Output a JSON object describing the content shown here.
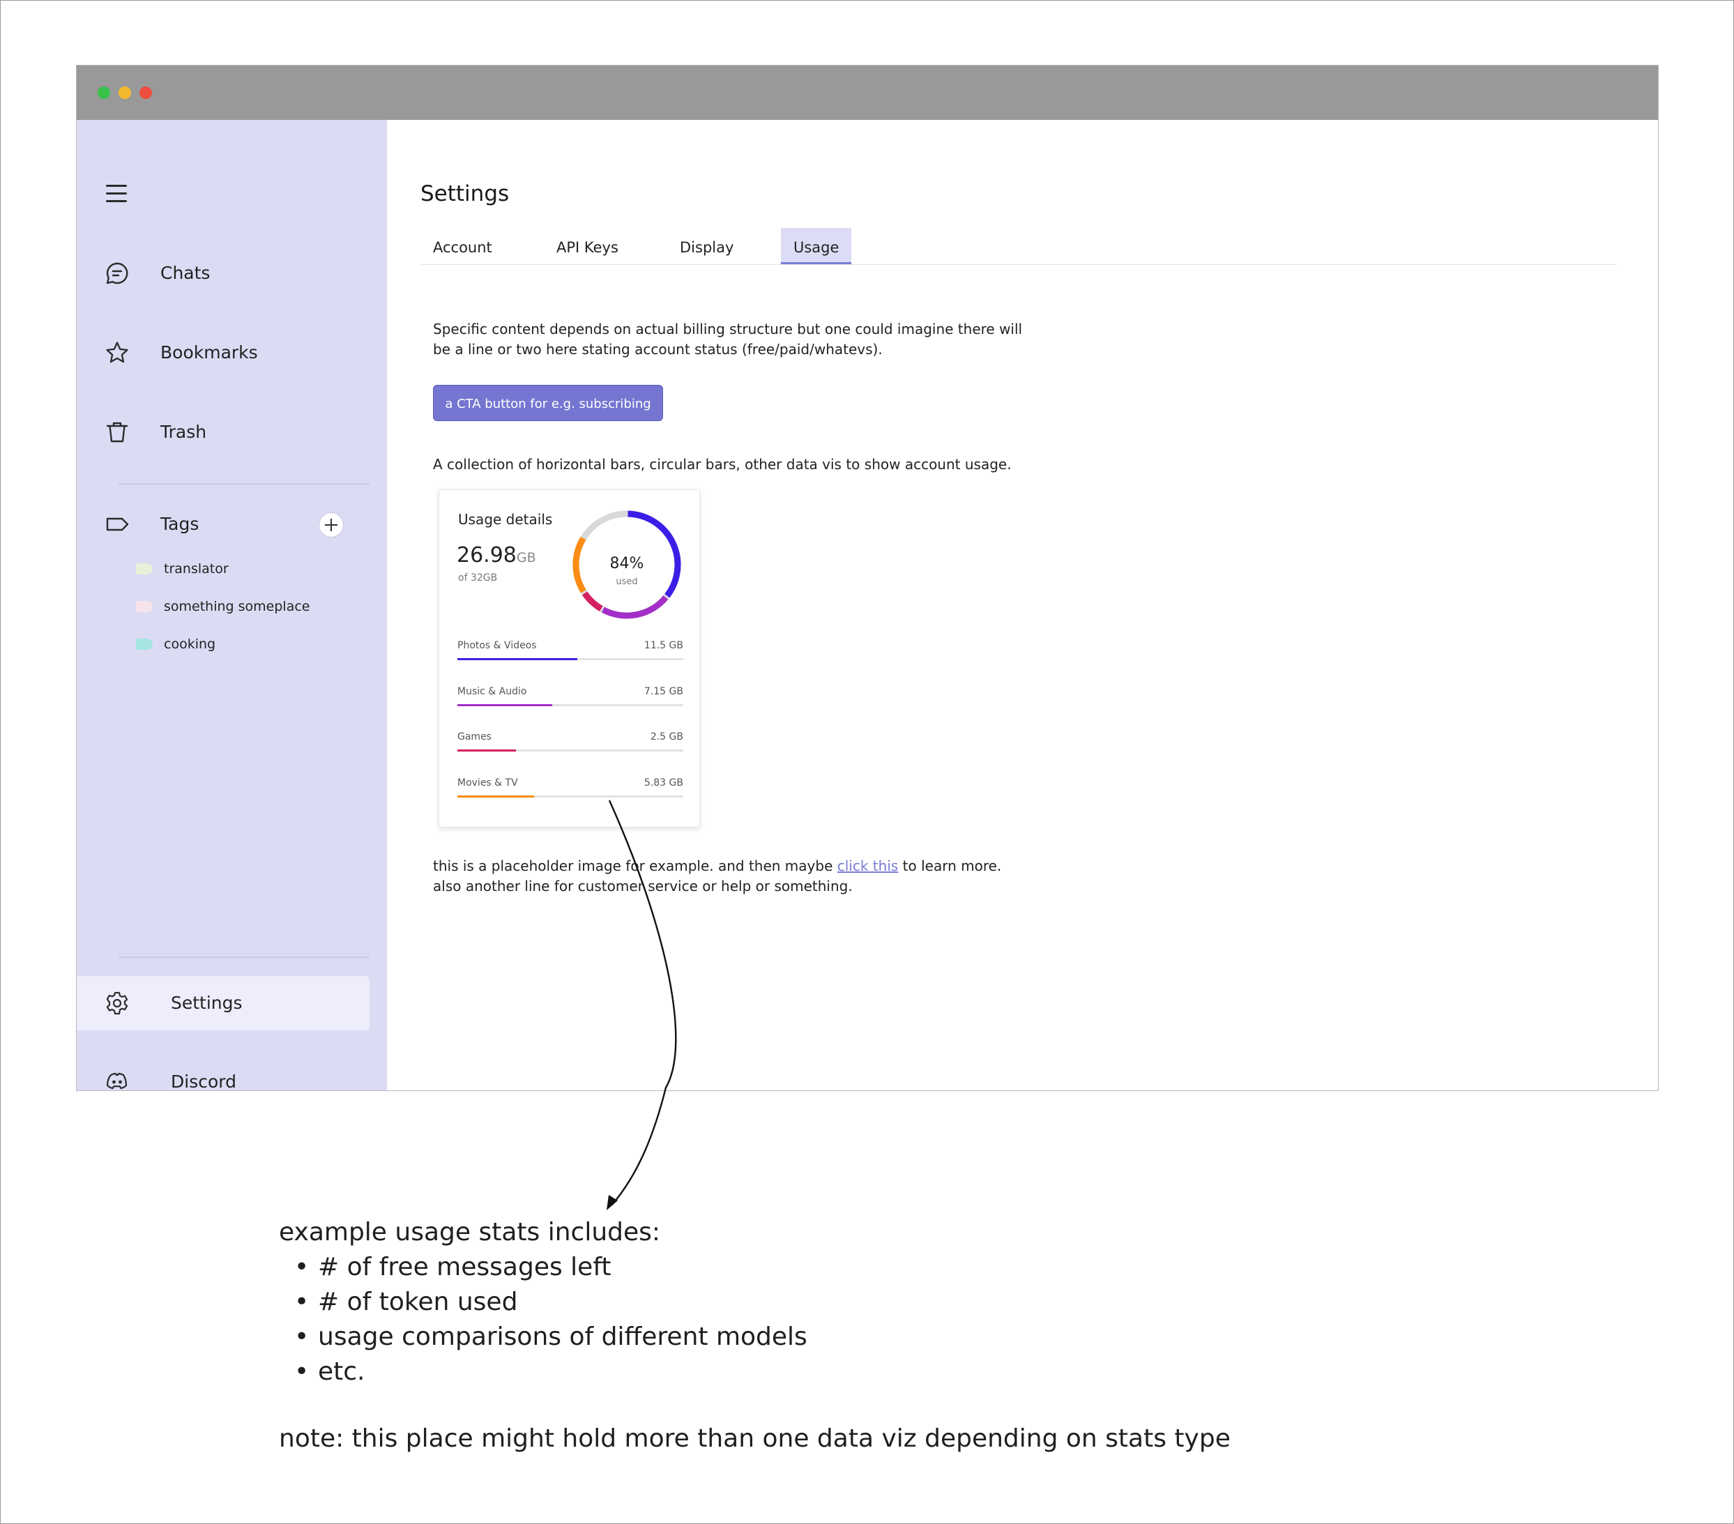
{
  "window": {
    "traffic_lights": [
      "#39c24a",
      "#f4b92f",
      "#ee4d3f"
    ]
  },
  "sidebar": {
    "menu_icon": "hamburger-menu-icon",
    "items": [
      {
        "label": "Chats",
        "icon": "chat-bubble-icon"
      },
      {
        "label": "Bookmarks",
        "icon": "star-icon"
      },
      {
        "label": "Trash",
        "icon": "trash-icon"
      }
    ],
    "tags_section": {
      "label": "Tags",
      "icon": "tag-icon",
      "add_icon": "plus-icon"
    },
    "tags": [
      {
        "label": "translator",
        "color": "#e6f1d8"
      },
      {
        "label": "something someplace",
        "color": "#f6e4ea"
      },
      {
        "label": "cooking",
        "color": "#a6e5e1"
      }
    ],
    "settings": {
      "label": "Settings",
      "icon": "gear-icon"
    },
    "discord": {
      "label": "Discord",
      "icon": "discord-icon"
    }
  },
  "main": {
    "title": "Settings",
    "tabs": [
      {
        "label": "Account",
        "active": false
      },
      {
        "label": "API Keys",
        "active": false
      },
      {
        "label": "Display",
        "active": false
      },
      {
        "label": "Usage",
        "active": true
      }
    ],
    "intro_line1": "Specific content depends on actual billing structure but one could imagine there will",
    "intro_line2": "be a line or two here stating account status (free/paid/whatevs).",
    "cta_label": "a CTA button for e.g. subscribing",
    "dataviz_caption": "A collection of horizontal bars, circular bars, other data vis to show account usage.",
    "footer_line1_pre": "this is a placeholder image for example. and then maybe ",
    "footer_link": "click this",
    "footer_line1_post": " to learn more.",
    "footer_line2": "also another line for customer service or help or something."
  },
  "usage_card": {
    "title": "Usage details",
    "used_value": "26.98",
    "used_unit": "GB",
    "of_total": "of 32GB",
    "percent_label": "84%",
    "percent_caption": "used",
    "percent": 84,
    "categories": [
      {
        "label": "Photos & Videos",
        "value": "11.5 GB",
        "fraction": 0.53,
        "color": "#3b1fe6"
      },
      {
        "label": "Music & Audio",
        "value": "7.15 GB",
        "fraction": 0.42,
        "color": "#a22fc7"
      },
      {
        "label": "Games",
        "value": "2.5 GB",
        "fraction": 0.26,
        "color": "#d52161"
      },
      {
        "label": "Movies & TV",
        "value": "5.83 GB",
        "fraction": 0.34,
        "color": "#fb8c14"
      }
    ],
    "ring_track_color": "#d9d9d9"
  },
  "notes": {
    "heading": "example usage stats includes:",
    "bullets": [
      "# of free messages left",
      "# of token used",
      "usage comparisons of different models",
      "etc."
    ],
    "note": "note: this place might hold more than one data viz depending on stats type"
  }
}
